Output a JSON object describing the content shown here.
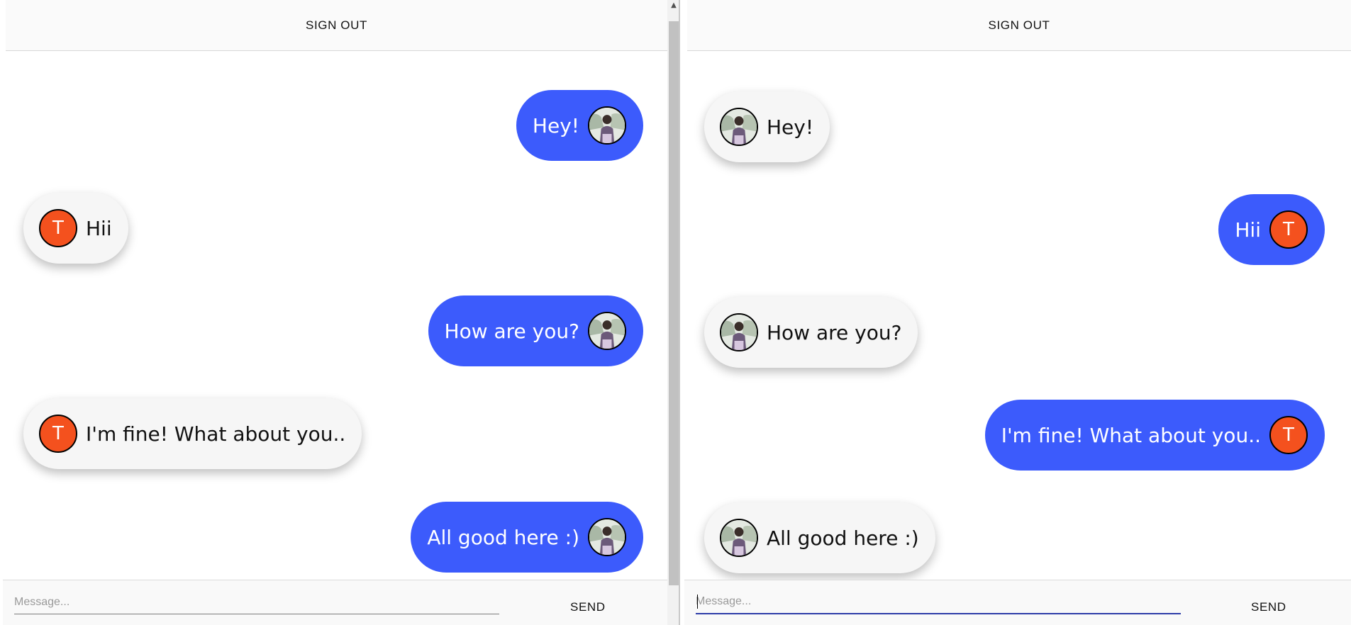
{
  "header": {
    "signout_label": "SIGN OUT"
  },
  "composer": {
    "placeholder": "Message...",
    "send_label": "SEND"
  },
  "avatar_letter": "T",
  "colors": {
    "sent_bubble": "#3c5bfc",
    "received_bubble": "#f6f6f6",
    "avatar_letter_bg": "#f4511e"
  },
  "left_panel": {
    "messages": [
      {
        "text": "Hey!",
        "direction": "sent",
        "avatar": "photo"
      },
      {
        "text": "Hii",
        "direction": "received",
        "avatar": "letter"
      },
      {
        "text": "How are you?",
        "direction": "sent",
        "avatar": "photo"
      },
      {
        "text": "I'm fine! What about you..",
        "direction": "received",
        "avatar": "letter"
      },
      {
        "text": "All good here :)",
        "direction": "sent",
        "avatar": "photo"
      }
    ]
  },
  "right_panel": {
    "messages": [
      {
        "text": "Hey!",
        "direction": "received",
        "avatar": "photo"
      },
      {
        "text": "Hii",
        "direction": "sent",
        "avatar": "letter"
      },
      {
        "text": "How are you?",
        "direction": "received",
        "avatar": "photo"
      },
      {
        "text": "I'm fine! What about you..",
        "direction": "sent",
        "avatar": "letter"
      },
      {
        "text": "All good here :)",
        "direction": "received",
        "avatar": "photo"
      }
    ]
  }
}
